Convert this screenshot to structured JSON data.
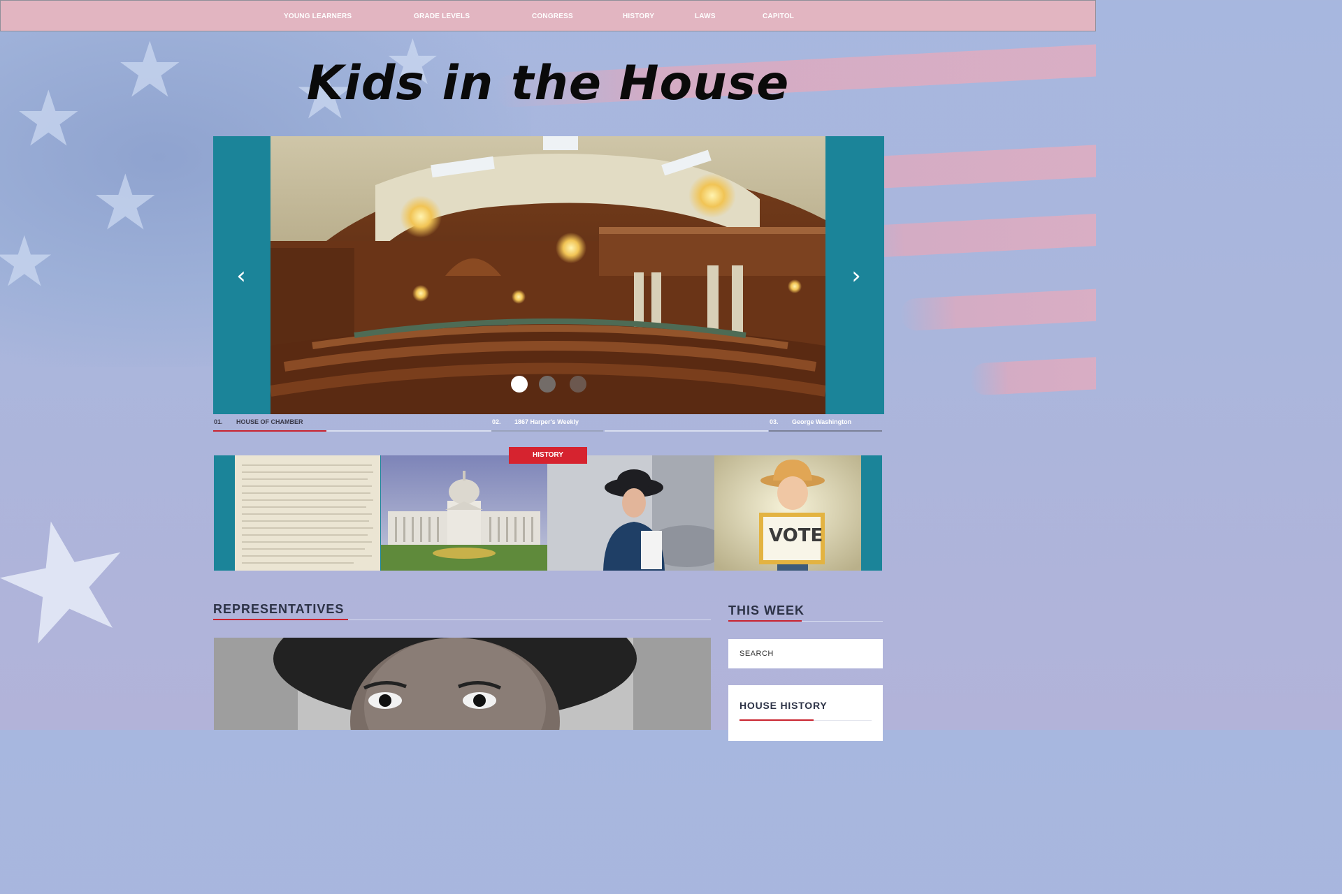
{
  "nav": {
    "items": [
      {
        "label": "YOUNG LEARNERS"
      },
      {
        "label": "GRADE LEVELS"
      },
      {
        "label": "CONGRESS"
      },
      {
        "label": "HISTORY"
      },
      {
        "label": "LAWS"
      },
      {
        "label": "CAPITOL"
      }
    ]
  },
  "site": {
    "title": "Kids in the House"
  },
  "slider": {
    "prev_icon": "chevron-left-icon",
    "next_icon": "chevron-right-icon",
    "active_index": 0,
    "captions": [
      {
        "number": "01.",
        "label": "HOUSE OF CHAMBER"
      },
      {
        "number": "02.",
        "label": "1867 Harper's Weekly"
      },
      {
        "number": "03.",
        "label": "George Washington"
      }
    ]
  },
  "history": {
    "badge": "HISTORY"
  },
  "representatives": {
    "title": "REPRESENTATIVES"
  },
  "sidebar": {
    "title": "THIS WEEK",
    "search_placeholder": "SEARCH",
    "card_title": "HOUSE HISTORY"
  },
  "vote_sign": "VOTE",
  "colors": {
    "nav_bg": "#e2b5c1",
    "teal": "#1b8499",
    "accent_red": "#d6232f",
    "heading": "#2c3246"
  }
}
